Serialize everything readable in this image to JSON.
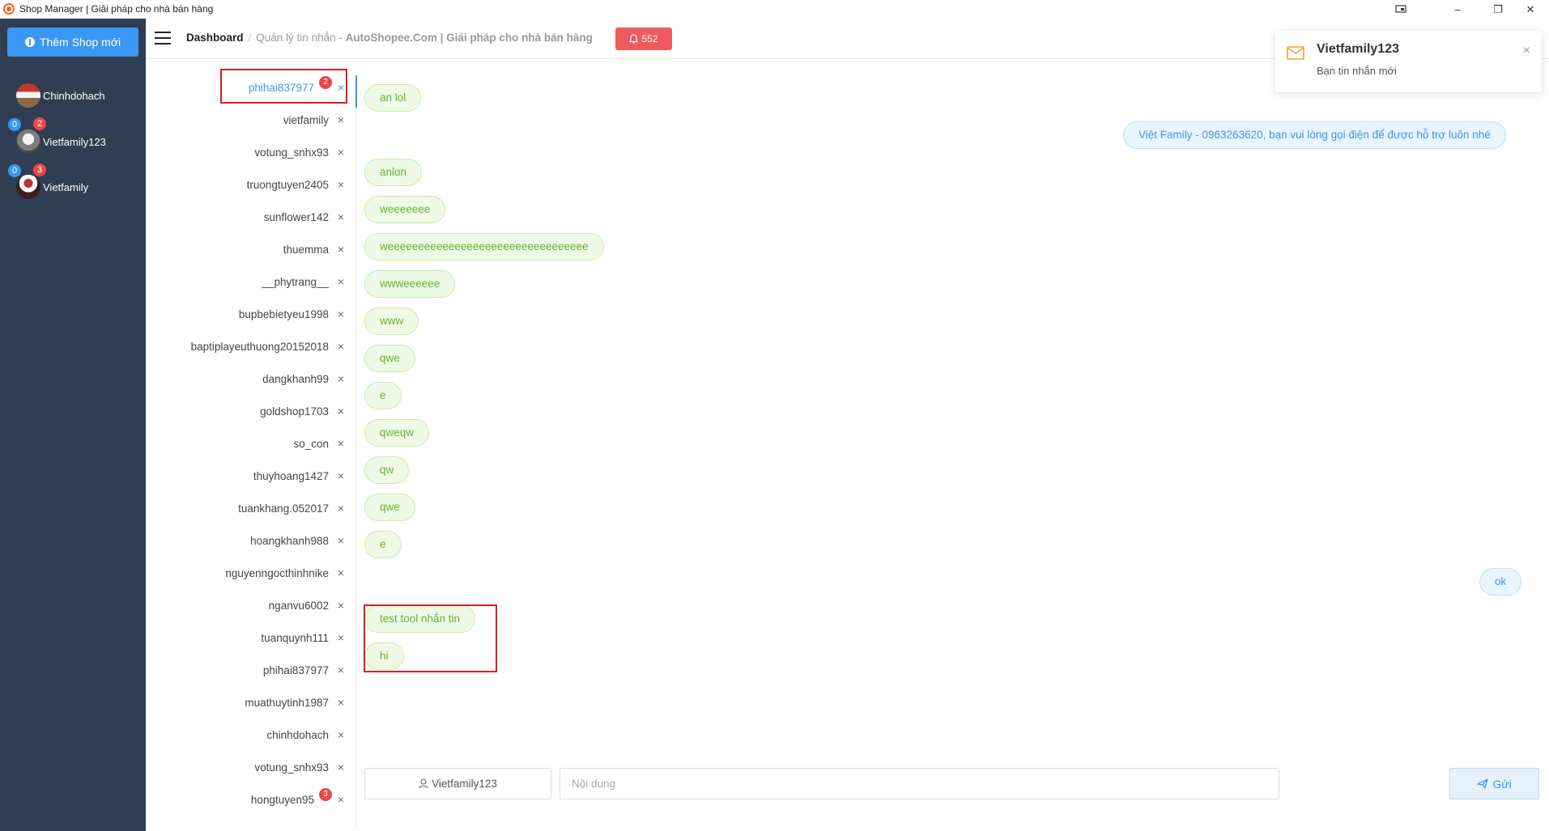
{
  "window": {
    "title": "Shop Manager | Giải pháp cho nhà bán hàng",
    "min_glyph": "–",
    "restore_glyph": "❐",
    "close_glyph": "✕"
  },
  "sidebar": {
    "add_shop_label": "Thêm Shop mới",
    "shops": [
      {
        "name": "Chinhdohach",
        "badge_blue": "",
        "badge_red": ""
      },
      {
        "name": "Vietfamily123",
        "badge_blue": "0",
        "badge_red": "2"
      },
      {
        "name": "Vietfamily",
        "badge_blue": "0",
        "badge_red": "3"
      }
    ]
  },
  "header": {
    "dashboard": "Dashboard",
    "separator": "/",
    "page": "Quản lý tin nhắn",
    "page_suffix": " - ",
    "brand": "AutoShopee.Com | Giải pháp cho nhà bán hàng",
    "notif_count": "552"
  },
  "conversations": [
    {
      "name": "phihai837977",
      "badge": "2",
      "active": true
    },
    {
      "name": "vietfamily",
      "badge": ""
    },
    {
      "name": "votung_snhx93",
      "badge": ""
    },
    {
      "name": "truongtuyen2405",
      "badge": ""
    },
    {
      "name": "sunflower142",
      "badge": ""
    },
    {
      "name": "thuemma",
      "badge": ""
    },
    {
      "name": "__phytrang__",
      "badge": ""
    },
    {
      "name": "bupbebietyeu1998",
      "badge": ""
    },
    {
      "name": "baptiplayeuthuong20152018",
      "badge": ""
    },
    {
      "name": "dangkhanh99",
      "badge": ""
    },
    {
      "name": "goldshop1703",
      "badge": ""
    },
    {
      "name": "so_con",
      "badge": ""
    },
    {
      "name": "thuyhoang1427",
      "badge": ""
    },
    {
      "name": "tuankhang.052017",
      "badge": ""
    },
    {
      "name": "hoangkhanh988",
      "badge": ""
    },
    {
      "name": "nguyenngocthinhnike",
      "badge": ""
    },
    {
      "name": "nganvu6002",
      "badge": ""
    },
    {
      "name": "tuanquynh111",
      "badge": ""
    },
    {
      "name": "phihai837977",
      "badge": ""
    },
    {
      "name": "muathuytinh1987",
      "badge": ""
    },
    {
      "name": "chinhdohach",
      "badge": ""
    },
    {
      "name": "votung_snhx93",
      "badge": ""
    },
    {
      "name": "hongtuyen95",
      "badge": "3"
    }
  ],
  "close_glyph": "×",
  "messages": [
    {
      "text": "an lol",
      "dir": "in"
    },
    {
      "text": "Việt Family - 0963263620, bạn vui lòng gọi điện để được hỗ trợ luôn nhé",
      "dir": "out"
    },
    {
      "text": "anlon",
      "dir": "in"
    },
    {
      "text": "weeeeeee",
      "dir": "in"
    },
    {
      "text": "weeeeeeeeeeeeeeeeeeeeeeeeeeeeeeeee",
      "dir": "in"
    },
    {
      "text": "wwweeeeee",
      "dir": "in"
    },
    {
      "text": "www",
      "dir": "in"
    },
    {
      "text": "qwe",
      "dir": "in"
    },
    {
      "text": "e",
      "dir": "in"
    },
    {
      "text": "qweqw",
      "dir": "in"
    },
    {
      "text": "qw",
      "dir": "in"
    },
    {
      "text": "qwe",
      "dir": "in"
    },
    {
      "text": "e",
      "dir": "in"
    },
    {
      "text": "ok",
      "dir": "out"
    },
    {
      "text": "test tool nhắn tin",
      "dir": "in"
    },
    {
      "text": "hi",
      "dir": "in"
    }
  ],
  "composer": {
    "user": "Vietfamily123",
    "placeholder": "Nội dung",
    "send_label": "Gửi"
  },
  "toast": {
    "title": "Vietfamily123",
    "body": "Bạn tin nhắn mới",
    "close_glyph": "×"
  }
}
